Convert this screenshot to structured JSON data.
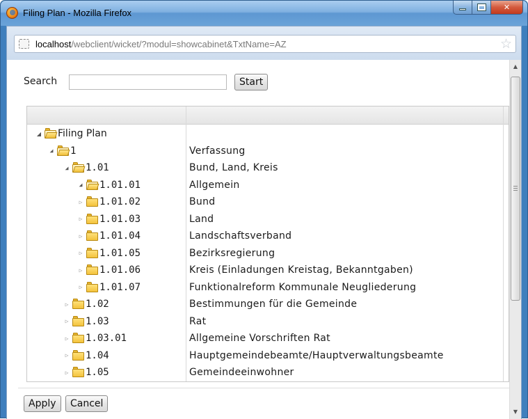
{
  "window": {
    "title": "Filing Plan - Mozilla Firefox",
    "controls": [
      "minimize",
      "maximize",
      "close"
    ]
  },
  "address_bar": {
    "host": "localhost",
    "path": "/webclient/wicket/?modul=showcabinet&TxtName=AZ"
  },
  "search": {
    "label": "Search",
    "value": "",
    "start_label": "Start"
  },
  "tree": {
    "columns": [
      "",
      ""
    ],
    "rows": [
      {
        "id": "Filing Plan",
        "desc": "",
        "level": 0,
        "expanded": true
      },
      {
        "id": "1",
        "desc": "Verfassung",
        "level": 1,
        "expanded": true
      },
      {
        "id": "1.01",
        "desc": "Bund, Land, Kreis",
        "level": 2,
        "expanded": true
      },
      {
        "id": "1.01.01",
        "desc": "Allgemein",
        "level": 3,
        "expanded": true
      },
      {
        "id": "1.01.02",
        "desc": "Bund",
        "level": 3,
        "expanded": false
      },
      {
        "id": "1.01.03",
        "desc": "Land",
        "level": 3,
        "expanded": false
      },
      {
        "id": "1.01.04",
        "desc": "Landschaftsverband",
        "level": 3,
        "expanded": false
      },
      {
        "id": "1.01.05",
        "desc": "Bezirksregierung",
        "level": 3,
        "expanded": false
      },
      {
        "id": "1.01.06",
        "desc": "Kreis (Einladungen Kreistag, Bekanntgaben)",
        "level": 3,
        "expanded": false
      },
      {
        "id": "1.01.07",
        "desc": "Funktionalreform Kommunale Neugliederung",
        "level": 3,
        "expanded": false
      },
      {
        "id": "1.02",
        "desc": "Bestimmungen für die Gemeinde",
        "level": 2,
        "expanded": false
      },
      {
        "id": "1.03",
        "desc": "Rat",
        "level": 2,
        "expanded": false
      },
      {
        "id": "1.03.01",
        "desc": "Allgemeine Vorschriften Rat",
        "level": 2,
        "expanded": false
      },
      {
        "id": "1.04",
        "desc": "Hauptgemeindebeamte/Hauptverwaltungsbeamte",
        "level": 2,
        "expanded": false
      },
      {
        "id": "1.05",
        "desc": "Gemeindeeinwohner",
        "level": 2,
        "expanded": false
      }
    ]
  },
  "footer": {
    "apply_label": "Apply",
    "cancel_label": "Cancel"
  },
  "colors": {
    "titlebar": "#7fb0e0",
    "folder": "#f3c23c",
    "close": "#c23a1e"
  }
}
